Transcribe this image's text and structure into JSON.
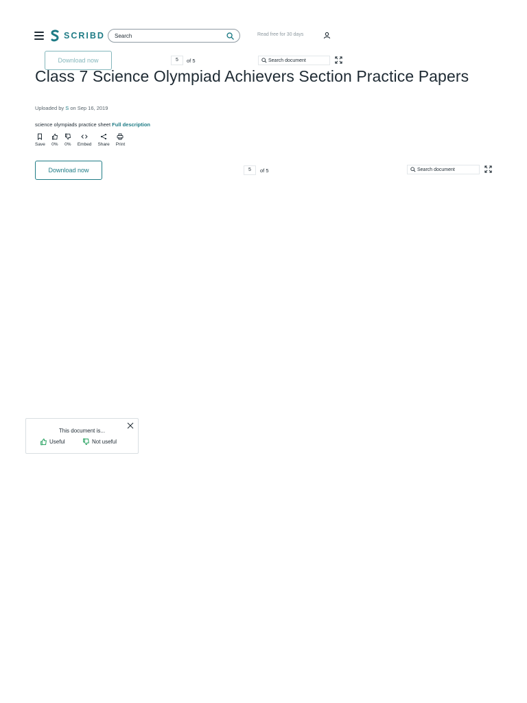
{
  "header": {
    "brand": "SCRIBD",
    "search_placeholder": "Search",
    "read_free": "Read free for 30 days"
  },
  "toolbar": {
    "download_label": "Download now",
    "page_current": "5",
    "page_total": "of 5",
    "search_doc_label": "Search document"
  },
  "document": {
    "title": "Class 7 Science Olympiad Achievers Section Practice Papers",
    "uploaded_prefix": "Uploaded by",
    "uploader": "S",
    "uploaded_suffix": "on Sep 16, 2019",
    "description": "science olympiads practice sheet",
    "full_description_link": "Full description"
  },
  "actions": [
    {
      "label": "Save",
      "icon": "bookmark-icon"
    },
    {
      "label": "0%",
      "icon": "thumbs-up-icon"
    },
    {
      "label": "0%",
      "icon": "thumbs-down-icon"
    },
    {
      "label": "Embed",
      "icon": "embed-code-icon"
    },
    {
      "label": "Share",
      "icon": "share-icon"
    },
    {
      "label": "Print",
      "icon": "print-icon"
    }
  ],
  "feedback": {
    "title": "This document is...",
    "useful": "Useful",
    "not_useful": "Not useful"
  },
  "colors": {
    "accent": "#1e7b85",
    "text": "#1e2a33",
    "muted": "#8b979e"
  }
}
